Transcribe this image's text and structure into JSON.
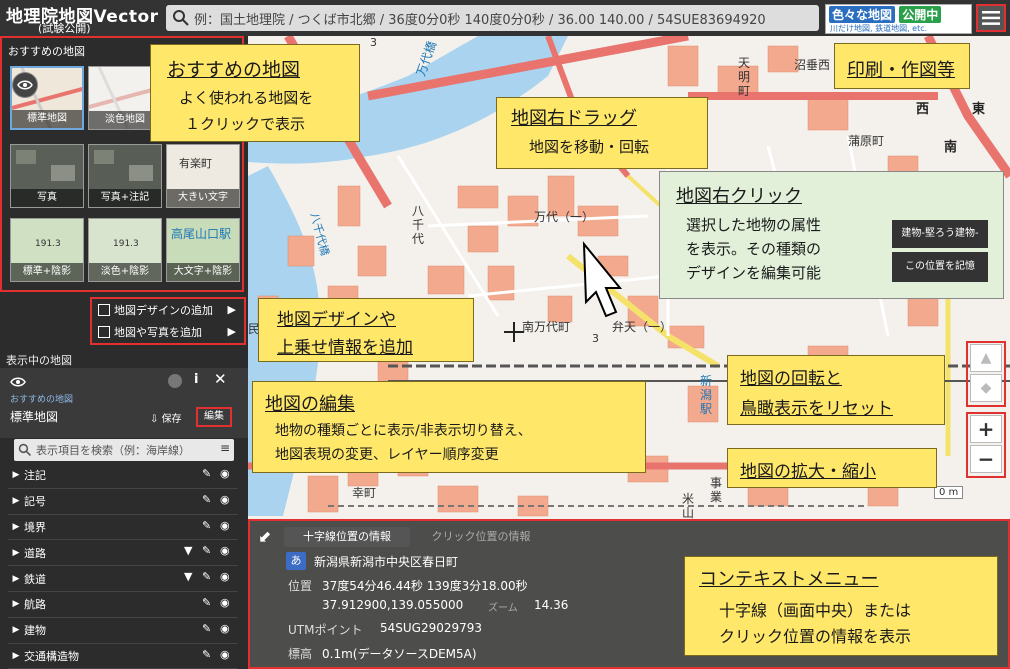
{
  "header": {
    "title": "地理院地図Vector",
    "subtitle": "(試験公開)",
    "search_placeholder": "例：国土地理院 / つくば市北郷 / 36度0分0秒 140度0分0秒 / 36.00 140.00 / 54SUE83694920",
    "banner_top_a": "色々な地図",
    "banner_top_b": "公開中",
    "banner_bottom": "川だけ地図, 鉄道地図, etc."
  },
  "sidebar": {
    "recommended_title": "おすすめの地図",
    "thumbnails": [
      {
        "label": "標準地図"
      },
      {
        "label": "淡色地図"
      },
      {
        "label": ""
      },
      {
        "label": "写真"
      },
      {
        "label": "写真+注記"
      },
      {
        "label": "大きい文字"
      },
      {
        "label": "標準+陰影"
      },
      {
        "label": "淡色+陰影"
      },
      {
        "label": "大文字+陰影"
      }
    ],
    "thumb_texts": {
      "t6": "有楽町",
      "t9": "高尾山口駅",
      "t7": "191.3",
      "t8": "191.3"
    },
    "menu_add_design": "地図デザインの追加",
    "menu_add_photo": "地図や写真を追加",
    "current_title": "表示中の地図",
    "current_source": "おすすめの地図",
    "current_map": "標準地図",
    "save_label": "保存",
    "edit_label": "編集",
    "filter_placeholder": "表示項目を検索（例：海岸線）",
    "layers": [
      {
        "label": "注記",
        "filter": false
      },
      {
        "label": "記号",
        "filter": false
      },
      {
        "label": "境界",
        "filter": false
      },
      {
        "label": "道路",
        "filter": true
      },
      {
        "label": "鉄道",
        "filter": true
      },
      {
        "label": "航路",
        "filter": false
      },
      {
        "label": "建物",
        "filter": false
      },
      {
        "label": "交通構造物",
        "filter": false
      }
    ]
  },
  "callouts": {
    "recommended": {
      "title": "おすすめの地図",
      "line1": "よく使われる地図を",
      "line2": "１クリックで表示"
    },
    "print": {
      "title": "印刷・作図等"
    },
    "drag": {
      "title": "地図右ドラッグ",
      "line1": "地図を移動・回転"
    },
    "click": {
      "title": "地図右クリック",
      "line1": "選択した地物の属性",
      "line2": "を表示。その種類の",
      "line3": "デザインを編集可能"
    },
    "context_btn1": "建物-堅ろう建物-",
    "context_btn2": "この位置を記憶",
    "add": {
      "line1": "地図デザインや",
      "line2": "上乗せ情報を追加"
    },
    "edit": {
      "title": "地図の編集",
      "line1": "地物の種類ごとに表示/非表示切り替え、",
      "line2": "地図表現の変更、レイヤー順序変更"
    },
    "reset": {
      "line1": "地図の回転と",
      "line2": "鳥瞰表示をリセット"
    },
    "zoom": {
      "title": "地図の拡大・縮小"
    },
    "context": {
      "title": "コンテキストメニュー",
      "line1": "十字線（画面中央）または",
      "line2": "クリック位置の情報を表示"
    }
  },
  "info": {
    "tab_crosshair": "十字線位置の情報",
    "tab_click": "クリック位置の情報",
    "address_badge": "あ",
    "address": "新潟県新潟市中央区春日町",
    "pos_label": "位置",
    "pos_dms": "37度54分46.44秒 139度3分18.00秒",
    "pos_decimal": "37.912900,139.055000",
    "zoom_label": "ズーム",
    "zoom_value": "14.36",
    "utm_label": "UTMポイント",
    "utm_value": "54SUG29029793",
    "elev_label": "標高",
    "elev_value": "0.1m(データソースDEM5A)"
  },
  "map_labels": {
    "bandai": "万代橋",
    "yachiyo": "八千代",
    "yachiyo_hashi": "八千代橋",
    "mandai1": "万代（一）",
    "minamimandai": "南万代町",
    "benten": "弁天（一）",
    "niigata_st": "新潟駅",
    "tenmyo": "天明町",
    "numatare": "沼垂西",
    "gamahara": "蒲原町",
    "west": "西",
    "east": "東",
    "south": "南",
    "saiwai": "幸町",
    "minbunka": "民文化会館",
    "num_3": "3",
    "num_3b": "3",
    "kome": "米山",
    "scale": "0 m",
    "jigyo": "事業"
  },
  "colors": {
    "callout": "#ffe76a",
    "callout_green": "#e2f0d9",
    "frame": "#e03030",
    "water": "#a9d3ee",
    "building": "#f3a98e",
    "road_main": "#e9736d",
    "rail": "#555555",
    "road_yellow": "#f5e26b"
  }
}
